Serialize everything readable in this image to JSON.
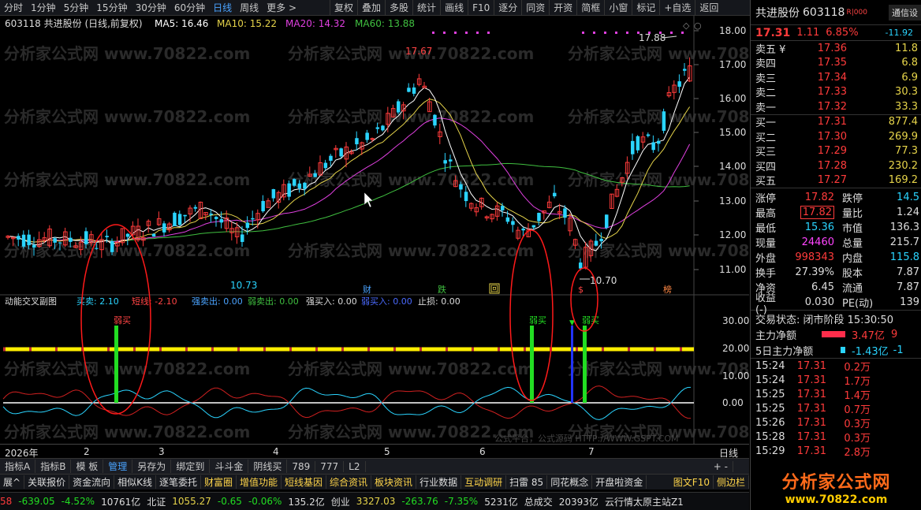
{
  "toolbar": {
    "periods": [
      "分时",
      "1分钟",
      "5分钟",
      "15分钟",
      "30分钟",
      "60分钟",
      "日线",
      "周线",
      "更多 >"
    ],
    "active_period": "日线",
    "tools": [
      "复权",
      "叠加",
      "多股",
      "统计",
      "画线",
      "F10",
      "逐分",
      "同资",
      "开资",
      "简框",
      "小窗",
      "标记",
      "+自选",
      "返回"
    ]
  },
  "stock": {
    "code": "603118",
    "name": "共进股份",
    "chart_header": "603118 共进股份 (日线,前复权)",
    "ma5": "MA5: 16.46",
    "ma10": "MA10: 15.22",
    "ma20": "MA20: 14.32",
    "ma60": "MA60: 13.88",
    "colors": {
      "ma5": "#ffffff",
      "ma10": "#e6d44a",
      "ma20": "#e040e0",
      "ma60": "#40c040",
      "up": "#ff3b3b",
      "down": "#2ad4ff"
    }
  },
  "chart_data": {
    "type": "candlestick",
    "y_axis_ticks": [
      "18.00",
      "17.00",
      "16.00",
      "15.00",
      "14.00",
      "13.00",
      "12.00",
      "11.00"
    ],
    "annotations": {
      "high1": "17.67",
      "high2": "17.88",
      "low1": "10.73",
      "low2": "10.70"
    },
    "event_markers": [
      "财",
      "跌",
      "回",
      "$",
      "榜"
    ],
    "x_axis_labels": [
      "2026年",
      "2",
      "3",
      "4",
      "5",
      "6",
      "7"
    ],
    "x_axis_right": "日线",
    "indicator": {
      "name": "动能交叉副图",
      "labels": [
        "买卖: 2.10",
        "短线: -2.10",
        "强卖出: 0.00",
        "弱卖出: 0.00",
        "强买入: 0.00",
        "弱买入: 0.00",
        "止损: 0.00"
      ],
      "signals": [
        "弱买",
        "弱买",
        "弱买"
      ],
      "y_axis_ticks": [
        "30.00",
        "20.00",
        "10.00",
        "0.00"
      ]
    },
    "watermark": "分析家公式网 www.70822.com",
    "footer_watermark": "公式平台，公式源码 HTTP://WWW.GSPT.COM"
  },
  "panel": {
    "title_name": "共进股份",
    "title_code": "603118",
    "title_flag": "R|000",
    "tab_label": "通信设",
    "price": "17.31",
    "change": "1.11",
    "pct": "6.85%",
    "right_val": "-11.92",
    "asks": [
      {
        "label": "卖五 ¥",
        "price": "17.36",
        "vol": "11.8"
      },
      {
        "label": "卖四",
        "price": "17.35",
        "vol": "6.8"
      },
      {
        "label": "卖三",
        "price": "17.34",
        "vol": "6.9"
      },
      {
        "label": "卖二",
        "price": "17.33",
        "vol": "30.3"
      },
      {
        "label": "卖一",
        "price": "17.32",
        "vol": "33.3"
      }
    ],
    "bids": [
      {
        "label": "买一",
        "price": "17.31",
        "vol": "877.4"
      },
      {
        "label": "买二",
        "price": "17.30",
        "vol": "269.9"
      },
      {
        "label": "买三",
        "price": "17.29",
        "vol": "77.3"
      },
      {
        "label": "买四",
        "price": "17.28",
        "vol": "230.2"
      },
      {
        "label": "买五",
        "price": "17.27",
        "vol": "169.2"
      }
    ],
    "stats": [
      {
        "l": "涨停",
        "v": "17.82",
        "l2": "跌停",
        "v2": "14.5"
      },
      {
        "l": "最高",
        "v": "17.82",
        "l2": "量比",
        "v2": "1.24"
      },
      {
        "l": "最低",
        "v": "15.36",
        "l2": "市值",
        "v2": "136.3"
      },
      {
        "l": "现量",
        "v": "24460",
        "l2": "总量",
        "v2": "215.7"
      },
      {
        "l": "外盘",
        "v": "998343",
        "l2": "内盘",
        "v2": "115.8"
      },
      {
        "l": "换手",
        "v": "27.39%",
        "l2": "股本",
        "v2": "7.87"
      },
      {
        "l": "净资",
        "v": "6.45",
        "l2": "流通",
        "v2": "7.87"
      },
      {
        "l": "收益(-)",
        "v": "0.030",
        "l2": "PE(动)",
        "v2": "139"
      }
    ],
    "trade_state": "交易状态: 闭市阶段 15:30:50",
    "main_net": "主力净额",
    "main_net_val": "3.47亿",
    "main_net_extra": "9",
    "five_day": "5日主力净额",
    "five_day_val": "-1.43亿",
    "five_day_extra": "-1",
    "ticks": [
      {
        "t": "15:24",
        "p": "17.31",
        "q": "0.2万"
      },
      {
        "t": "15:24",
        "p": "17.31",
        "q": "1.7万"
      },
      {
        "t": "15:25",
        "p": "17.31",
        "q": "1.4万"
      },
      {
        "t": "15:25",
        "p": "17.31",
        "q": "0.7万"
      },
      {
        "t": "15:26",
        "p": "17.31",
        "q": "0.3万"
      },
      {
        "t": "15:28",
        "p": "17.31",
        "q": "0.3万"
      },
      {
        "t": "15:29",
        "p": "17.31",
        "q": "2.8万"
      }
    ],
    "logo_text": "分析家公式网",
    "logo_url": "www.70822.com"
  },
  "bottom_tabs": [
    "指标A",
    "指标B",
    "模 板",
    "管理",
    "另存为",
    "绑定到",
    "斗斗金",
    "阴线买",
    "789",
    "777",
    "L2"
  ],
  "bottom_tabs_active": "管理",
  "bottom_tabs_right": "+  -",
  "links": [
    "展^",
    "关联报价",
    "资金流向",
    "相似K线",
    "逐笔委托",
    "财富圈",
    "增值功能",
    "短线基因",
    "综合资讯",
    "板块资讯",
    "行业数据",
    "互动调研",
    "扫雷 85",
    "同花概念",
    "开盘啦资金"
  ],
  "links_right": [
    "图文F10",
    "侧边栏"
  ],
  "statusbar": {
    "s1": "58",
    "s2": "-639.05",
    "s3": "-4.52%",
    "s4": "10761亿",
    "s5": "北证",
    "s6": "1055.27",
    "s7": "-0.65",
    "s8": "-0.06%",
    "s9": "135.2亿",
    "s10": "创业",
    "s11": "3327.03",
    "s12": "-263.76",
    "s13": "-7.35%",
    "s14": "5231亿",
    "s15": "总成交",
    "s16": "20393亿",
    "s17": "云行情太原主站Z1"
  }
}
